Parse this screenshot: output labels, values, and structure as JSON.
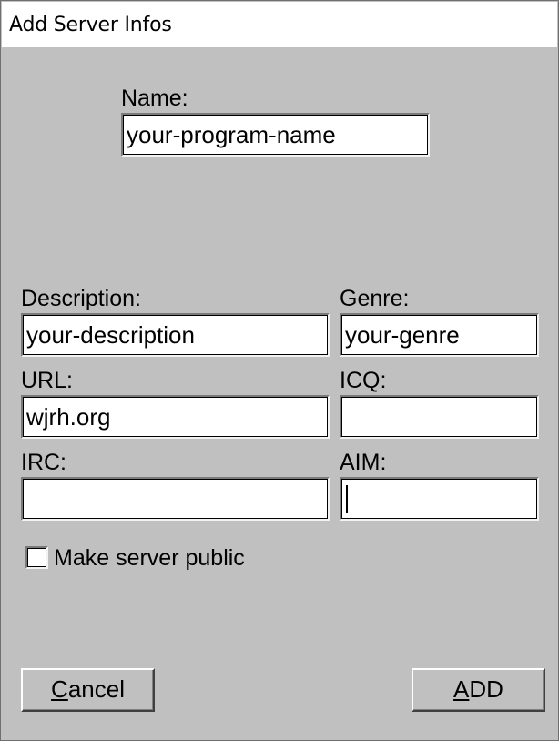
{
  "window": {
    "title": "Add Server Infos"
  },
  "form": {
    "name_label": "Name:",
    "name_value": "your-program-name",
    "description_label": "Description:",
    "description_value": "your-description",
    "genre_label": "Genre:",
    "genre_value": "your-genre",
    "url_label": "URL:",
    "url_value": "wjrh.org",
    "icq_label": "ICQ:",
    "icq_value": "",
    "irc_label": "IRC:",
    "irc_value": "",
    "aim_label": "AIM:",
    "aim_value": "",
    "public_label": "Make server public",
    "public_checked": false
  },
  "buttons": {
    "cancel_mnemonic": "C",
    "cancel_rest": "ancel",
    "add_mnemonic": "A",
    "add_rest": "DD"
  }
}
